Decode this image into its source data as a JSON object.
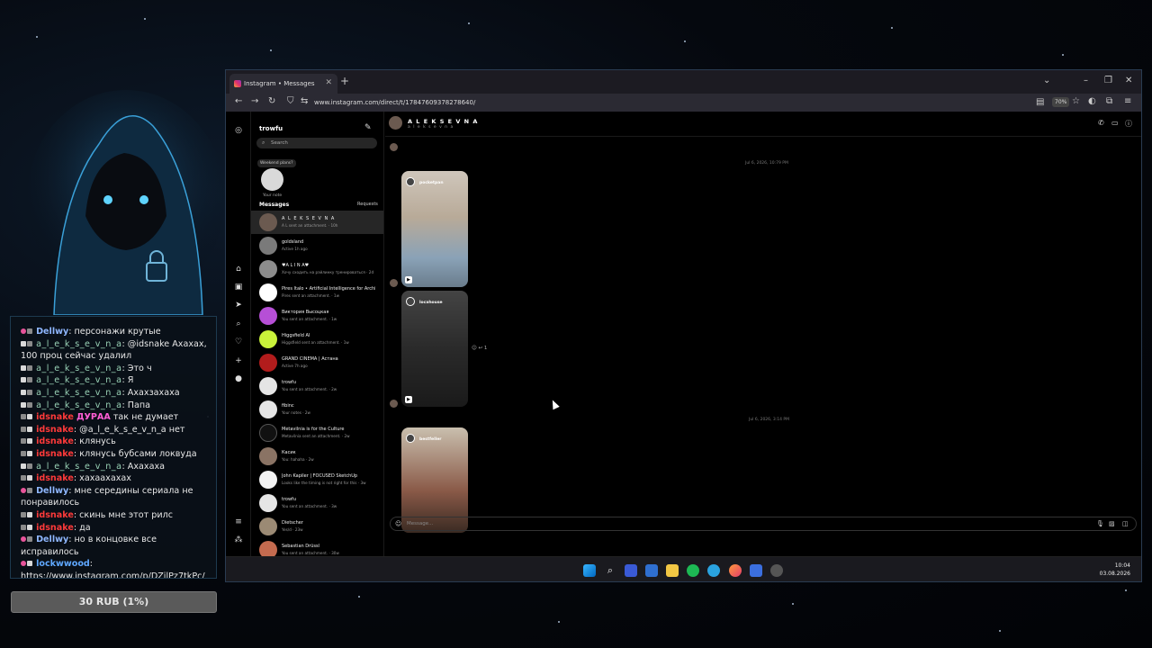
{
  "stream_chat": {
    "lines": [
      {
        "user": "Dellwy",
        "text": ": персонажи крутые"
      },
      {
        "user": "a_l_e_k_s_e_v_n_a",
        "text": ": @idsnake Ахахах, 100 проц сейчас удалил"
      },
      {
        "user": "a_l_e_k_s_e_v_n_a",
        "text": ": Это ч"
      },
      {
        "user": "a_l_e_k_s_e_v_n_a",
        "text": ": Я"
      },
      {
        "user": "a_l_e_k_s_e_v_n_a",
        "text": ": Ахахзахаха"
      },
      {
        "user": "a_l_e_k_s_e_v_n_a",
        "text": ": Папа"
      },
      {
        "user": "idsnake",
        "highlight": "ДУРАА",
        "text": " так не думает"
      },
      {
        "user": "idsnake",
        "text": ": @a_l_e_k_s_e_v_n_a нет"
      },
      {
        "user": "idsnake",
        "text": ": клянусь"
      },
      {
        "user": "idsnake",
        "text": ": клянусь бубсами локвуда"
      },
      {
        "user": "a_l_e_k_s_e_v_n_a",
        "text": ": Ахахаха"
      },
      {
        "user": "idsnake",
        "text": ": хахаахахах"
      },
      {
        "user": "Dellwy",
        "text": ": мне середины сериала не понравилось"
      },
      {
        "user": "idsnake",
        "text": ": скинь мне этот рилс"
      },
      {
        "user": "idsnake",
        "text": ": да"
      },
      {
        "user": "Dellwy",
        "text": ": но в концовке все исправилось"
      },
      {
        "user": "lockwwood",
        "text": ": https://www.instagram.com/p/DZilPz7tkPc/"
      }
    ],
    "donation": "30 RUB (1%)"
  },
  "browser": {
    "tab_title": "Instagram • Messages",
    "url": "www.instagram.com/direct/t/17847609378278640/",
    "zoom": "70%"
  },
  "instagram": {
    "username": "trowfu",
    "search_placeholder": "Search",
    "note_bubble": "Weekend plans?",
    "note_label": "Your note",
    "messages_heading": "Messages",
    "requests_label": "Requests",
    "conversations": [
      {
        "name": "A L E K S E V N A",
        "sub": "A L sent an attachment. · 10h"
      },
      {
        "name": "goldsland",
        "sub": "Active 1h ago"
      },
      {
        "name": "♥A L I N A♥",
        "sub": "Хочу сходить на рэйлинку тренироваться · 2d"
      },
      {
        "name": "Pires Italo • Artificial Intelligence for Archi...",
        "sub": "Pires sent an attachment. · 1w"
      },
      {
        "name": "Виктория Высоцкая",
        "sub": "You sent an attachment. · 1w"
      },
      {
        "name": "Higgsfield AI",
        "sub": "Higgsfield sent an attachment. · 1w"
      },
      {
        "name": "GRAND CINEMA | Астана",
        "sub": "Active 7h ago"
      },
      {
        "name": "trowfu",
        "sub": "You sent an attachment. · 2w"
      },
      {
        "name": "fibinc",
        "sub": "Your notes · 2w"
      },
      {
        "name": "Metavilnia is for the Culture",
        "sub": "Metavilnia sent an attachment. · 2w"
      },
      {
        "name": "Касик",
        "sub": "You: hahaha · 2w"
      },
      {
        "name": "John Kapiler | FOCUSED SketchUp",
        "sub": "Looks like the timing is not right for this · 3w"
      },
      {
        "name": "trowfu",
        "sub": "You sent an attachment. · 3w"
      },
      {
        "name": "Dietscher",
        "sub": "Yes/d · 23w"
      },
      {
        "name": "Sebastian Drüssl",
        "sub": "You sent an attachment. · 30w"
      }
    ],
    "thread": {
      "name": "A L E K S E V N A",
      "handle": "a l e k s e v n a",
      "timestamp_1": "Jul 6, 2026, 10:79 PM",
      "timestamp_2": "Jul 6, 2026, 3:14 PM",
      "media_users": [
        "pocketpan",
        "locahouse",
        "bestfeller"
      ],
      "reaction_count": "1",
      "input_placeholder": "Message..."
    }
  },
  "taskbar": {
    "time": "10:04",
    "date": "03.08.2026"
  },
  "colors": {
    "accent_blue": "#5fa8ff",
    "idsnake_red": "#ff3a3a",
    "frame_border": "#2a3c52"
  }
}
